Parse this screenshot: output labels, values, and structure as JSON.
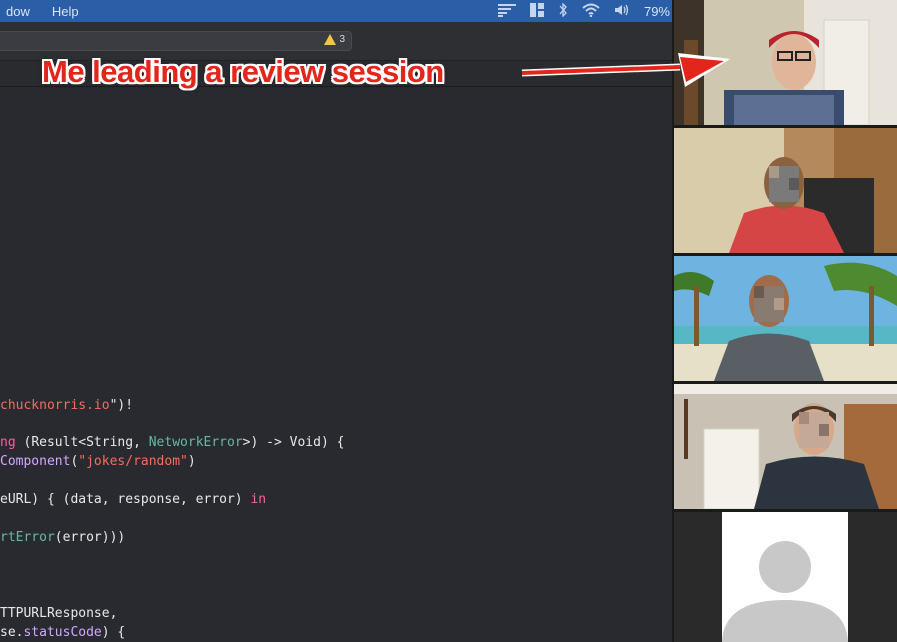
{
  "menubar": {
    "menus": [
      "dow",
      "Help"
    ],
    "battery": "79%"
  },
  "toolbar": {
    "warning_count": "3"
  },
  "code_lines": [
    [
      {
        "t": "chucknorris.io",
        "c": "str"
      },
      {
        "t": "\")!",
        "c": ""
      }
    ],
    [
      {
        "t": "ng ",
        "c": "kw"
      },
      {
        "t": "(",
        "c": ""
      },
      {
        "t": "Result",
        "c": ""
      },
      {
        "t": "<",
        "c": ""
      },
      {
        "t": "String",
        "c": ""
      },
      {
        "t": ", ",
        "c": ""
      },
      {
        "t": "NetworkError",
        "c": "fn"
      },
      {
        "t": ">) -> ",
        "c": ""
      },
      {
        "t": "Void",
        "c": ""
      },
      {
        "t": ") {",
        "c": ""
      }
    ],
    [
      {
        "t": "Component",
        "c": "ty"
      },
      {
        "t": "(",
        "c": ""
      },
      {
        "t": "\"jokes/random\"",
        "c": "str"
      },
      {
        "t": ")",
        "c": ""
      }
    ],
    [
      {
        "t": "eURL) { (data, response, error) ",
        "c": ""
      },
      {
        "t": "in",
        "c": "kw"
      }
    ],
    [
      {
        "t": "rtError",
        "c": "fn"
      },
      {
        "t": "(error)))",
        "c": ""
      }
    ],
    [
      {
        "t": "TTPURLResponse,",
        "c": ""
      }
    ],
    [
      {
        "t": "se.",
        "c": ""
      },
      {
        "t": "statusCode",
        "c": "ty"
      },
      {
        "t": ") {",
        "c": ""
      }
    ]
  ],
  "annotation": {
    "text": "Me leading a review session",
    "color": "#e3261c"
  },
  "icons": {
    "warning": "warning-triangle-icon",
    "bluetooth": "bluetooth-icon",
    "wifi": "wifi-icon",
    "volume": "volume-icon",
    "layout": "window-layout-icon",
    "bars": "menu-bars-icon"
  }
}
